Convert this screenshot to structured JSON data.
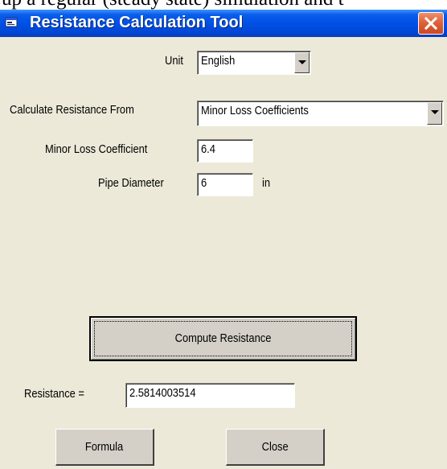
{
  "background_text": "up a regular (steady state) simulation and t",
  "window": {
    "title": "Resistance Calculation Tool"
  },
  "form": {
    "unit_label": "Unit",
    "unit_value": "English",
    "calc_from_label": "Calculate Resistance From",
    "calc_from_value": "Minor Loss Coefficients",
    "minor_loss_label": "Minor Loss Coefficient",
    "minor_loss_value": "6.4",
    "pipe_diameter_label": "Pipe Diameter",
    "pipe_diameter_value": "6",
    "pipe_diameter_unit": "in",
    "resistance_label": "Resistance =",
    "resistance_value": "2.5814003514"
  },
  "buttons": {
    "compute": "Compute Resistance",
    "formula": "Formula",
    "close": "Close"
  },
  "icons": {
    "app": "app-window-icon",
    "close": "close-x-icon",
    "dropdown": "chevron-down-icon"
  },
  "colors": {
    "titlebar": "#0050E5",
    "dialog_bg": "#ECE9D8",
    "close_button": "#E0623A"
  }
}
